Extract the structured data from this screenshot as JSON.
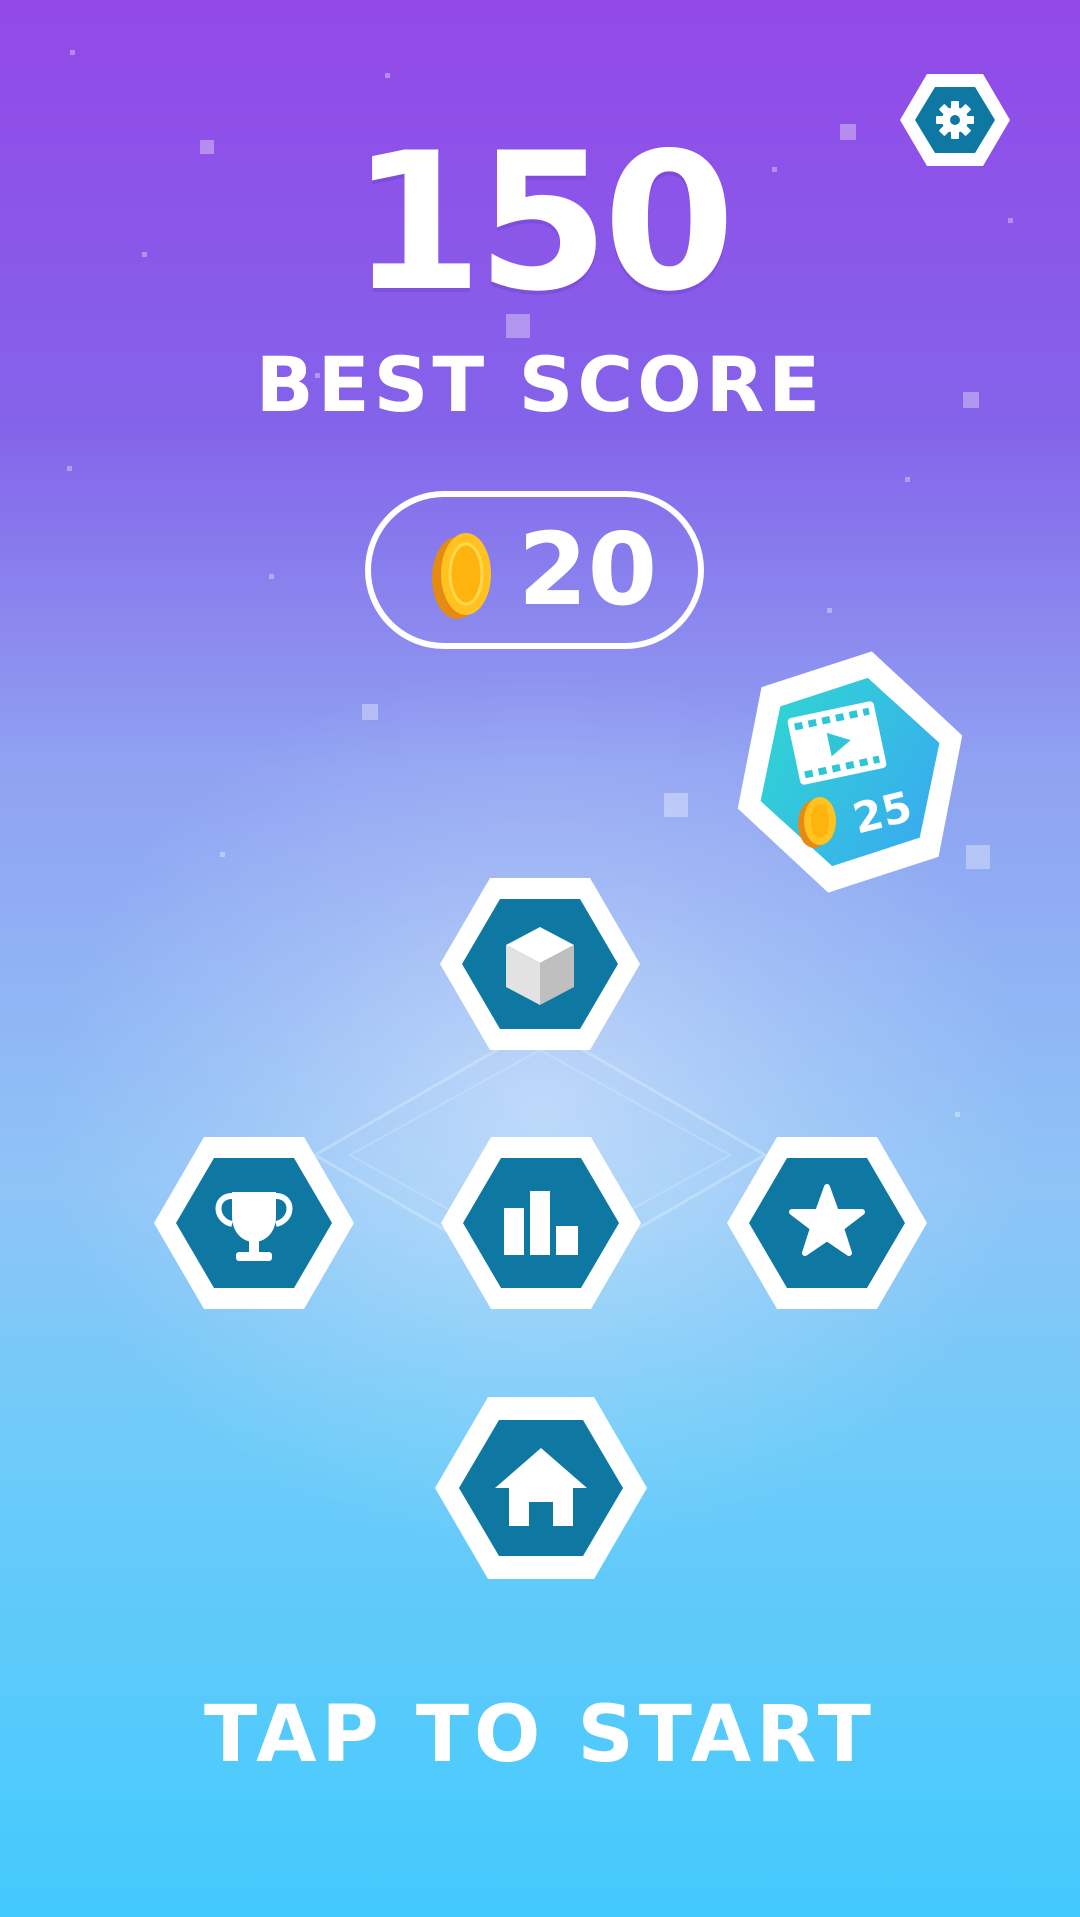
{
  "header": {
    "best_score_value": "150",
    "best_score_label": "BEST SCORE"
  },
  "coins": {
    "amount": "20",
    "icon": "coin-icon"
  },
  "reward_video": {
    "icon": "video-film-icon",
    "reward_amount": "25"
  },
  "menu": {
    "buttons": [
      {
        "name": "shop-cube-button",
        "icon": "cube-icon"
      },
      {
        "name": "achievements-button",
        "icon": "trophy-icon"
      },
      {
        "name": "leaderboard-button",
        "icon": "bar-chart-icon"
      },
      {
        "name": "rate-button",
        "icon": "star-icon"
      },
      {
        "name": "home-button",
        "icon": "home-icon"
      },
      {
        "name": "settings-button",
        "icon": "gear-icon"
      }
    ]
  },
  "footer": {
    "tap_label": "TAP TO START"
  },
  "colors": {
    "button_fill": "#0E77A2",
    "button_border": "#FFFFFF",
    "coin": "#FFC21F",
    "bg_top": "#9348E8",
    "bg_bottom": "#43C9FD"
  }
}
